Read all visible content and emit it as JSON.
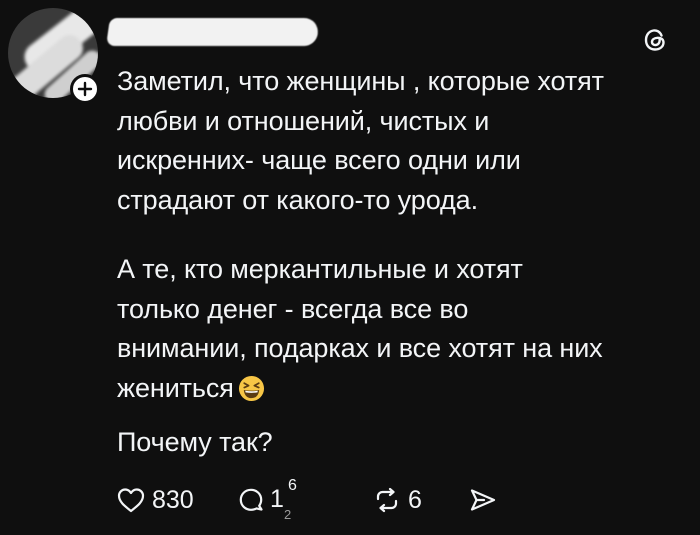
{
  "post": {
    "author_redacted": true,
    "paragraphs": [
      [
        "Заметил, что женщины , которые хотят",
        "любви и отношений, чистых и",
        "искренних- чаще всего одни или",
        "страдают от какого-то урода."
      ],
      [
        "А те, кто меркантильные и хотят",
        "только денег - всегда все во",
        "внимании, подарках и все хотят на них",
        "жениться"
      ],
      [
        "Почему так?"
      ]
    ],
    "emoji": "grinning-squinting-face",
    "p1": {
      "l1": "Заметил, что женщины , которые хотят",
      "l2": "любви и отношений, чистых и",
      "l3": "искренних- чаще всего одни или",
      "l4": "страдают от какого-то урода."
    },
    "p2": {
      "l1": "А те, кто меркантильные и хотят",
      "l2": "только денег - всегда все во",
      "l3": "внимании, подарках и все хотят на них",
      "l4": "жениться"
    },
    "p3": {
      "l1": "Почему так?"
    }
  },
  "actions": {
    "like_count": "830",
    "reply_count_main": "1",
    "reply_count_top": "6",
    "reply_count_bottom": "2",
    "repost_count": "6"
  },
  "icons": {
    "header": "threads-logo-icon",
    "follow": "plus-icon",
    "like": "heart-icon",
    "reply": "comment-bubble-icon",
    "repost": "repost-icon",
    "share": "send-icon"
  },
  "colors": {
    "background": "#0f0f0f",
    "text": "#f3f5f7",
    "emoji_face": "#f7c646"
  }
}
